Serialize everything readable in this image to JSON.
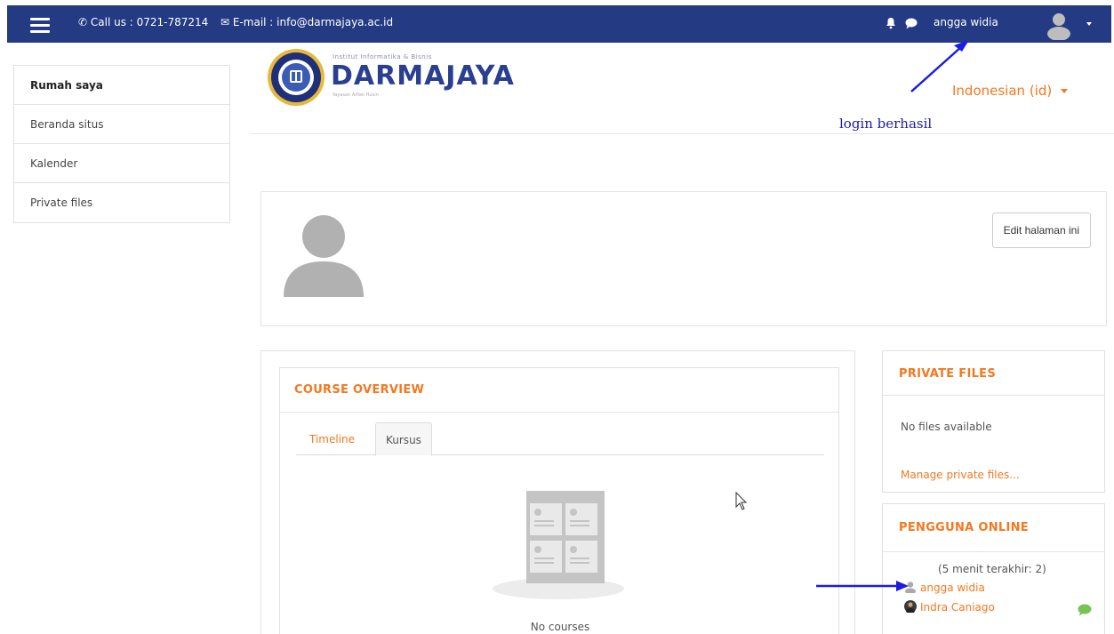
{
  "topbar": {
    "phone_text": "Call us : 0721-787214",
    "email_text": "E-mail : info@darmajaya.ac.id",
    "username": "angga widia",
    "bg_color": "#243a83"
  },
  "sidebar": {
    "items": [
      {
        "label": "Rumah saya"
      },
      {
        "label": "Beranda situs"
      },
      {
        "label": "Kalender"
      },
      {
        "label": "Private files"
      }
    ]
  },
  "header": {
    "logo_small": "Institut Informatika & Bisnis",
    "logo_big": "DARMAJAYA",
    "logo_tiny": "Yayasan Alfian Husin",
    "language": "Indonesian (id)",
    "annotation": "login berhasil"
  },
  "profile": {
    "edit_button": "Edit halaman ini"
  },
  "course_overview": {
    "title": "COURSE OVERVIEW",
    "tabs": [
      {
        "label": "Timeline"
      },
      {
        "label": "Kursus"
      }
    ],
    "empty_text": "No courses"
  },
  "private_files": {
    "title": "PRIVATE FILES",
    "empty_text": "No files available",
    "manage_link": "Manage private files..."
  },
  "online_users": {
    "title": "PENGGUNA ONLINE",
    "subtitle": "(5 menit terakhir: 2)",
    "users": [
      {
        "name": "angga widia"
      },
      {
        "name": "Indra Caniago"
      }
    ]
  },
  "colors": {
    "accent": "#f4781f",
    "brand": "#243a83",
    "annotation": "#1c1ca8"
  }
}
